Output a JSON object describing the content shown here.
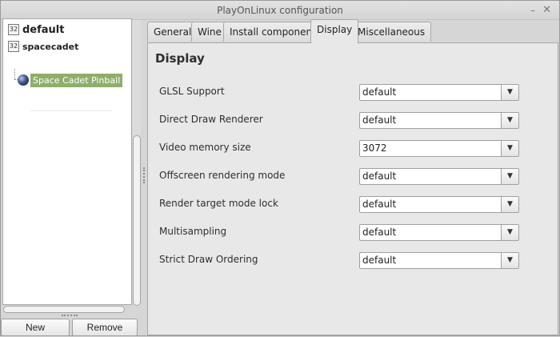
{
  "window": {
    "title": "PlayOnLinux configuration",
    "minimize_glyph": "–",
    "close_glyph": "✕"
  },
  "tree": {
    "prefixes": [
      {
        "badge": "32",
        "name": "default"
      },
      {
        "badge": "32",
        "name": "spacecadet"
      }
    ],
    "apps": [
      {
        "name": "Space Cadet Pinball",
        "icon": "pinball-ball-icon",
        "selected": true
      }
    ],
    "selected_color": "#8fae6b"
  },
  "buttons": {
    "new_label": "New",
    "remove_label": "Remove"
  },
  "tabs": [
    {
      "label": "General",
      "active": false
    },
    {
      "label": "Wine",
      "active": false
    },
    {
      "label": "Install components",
      "active": false
    },
    {
      "label": "Display",
      "active": true
    },
    {
      "label": "Miscellaneous",
      "active": false
    }
  ],
  "display": {
    "heading": "Display",
    "settings": [
      {
        "label": "GLSL Support",
        "value": "default"
      },
      {
        "label": "Direct Draw Renderer",
        "value": "default"
      },
      {
        "label": "Video memory size",
        "value": "3072"
      },
      {
        "label": "Offscreen rendering mode",
        "value": "default"
      },
      {
        "label": "Render target mode lock",
        "value": "default"
      },
      {
        "label": "Multisampling",
        "value": "default"
      },
      {
        "label": "Strict Draw Ordering",
        "value": "default"
      }
    ],
    "dropdown_glyph": "▼"
  }
}
